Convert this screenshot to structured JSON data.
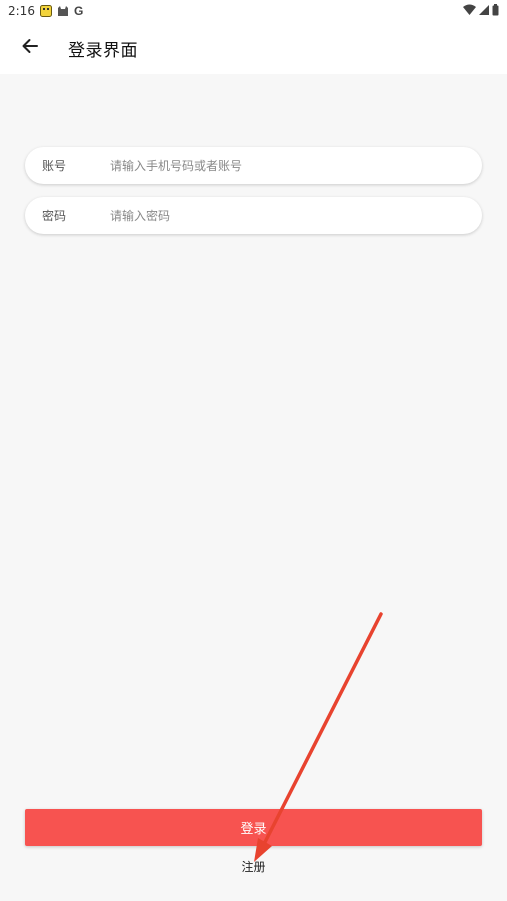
{
  "status_bar": {
    "time": "2:16",
    "g_letter": "G"
  },
  "app_bar": {
    "title": "登录界面"
  },
  "form": {
    "account_label": "账号",
    "account_placeholder": "请输入手机号码或者账号",
    "password_label": "密码",
    "password_placeholder": "请输入密码"
  },
  "actions": {
    "login_label": "登录",
    "register_label": "注册"
  },
  "colors": {
    "accent": "#f75350",
    "annotation": "#e8432f"
  },
  "icons": {
    "back": "arrow-back-icon",
    "wifi": "wifi-icon",
    "signal": "signal-icon",
    "battery": "battery-icon"
  }
}
